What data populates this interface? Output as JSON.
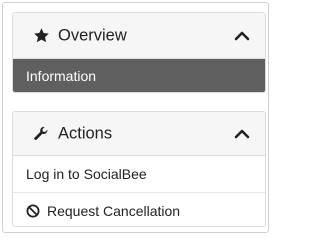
{
  "overview": {
    "title": "Overview",
    "icon": "star-icon",
    "items": [
      {
        "label": "Information",
        "active": true
      }
    ]
  },
  "actions": {
    "title": "Actions",
    "icon": "wrench-icon",
    "items": [
      {
        "label": "Log in to SocialBee"
      },
      {
        "label": "Request Cancellation",
        "icon": "ban-icon"
      }
    ]
  },
  "colors": {
    "active_bg": "#5f5f5f",
    "header_bg": "#f6f6f6",
    "border": "#dcdcdc"
  }
}
